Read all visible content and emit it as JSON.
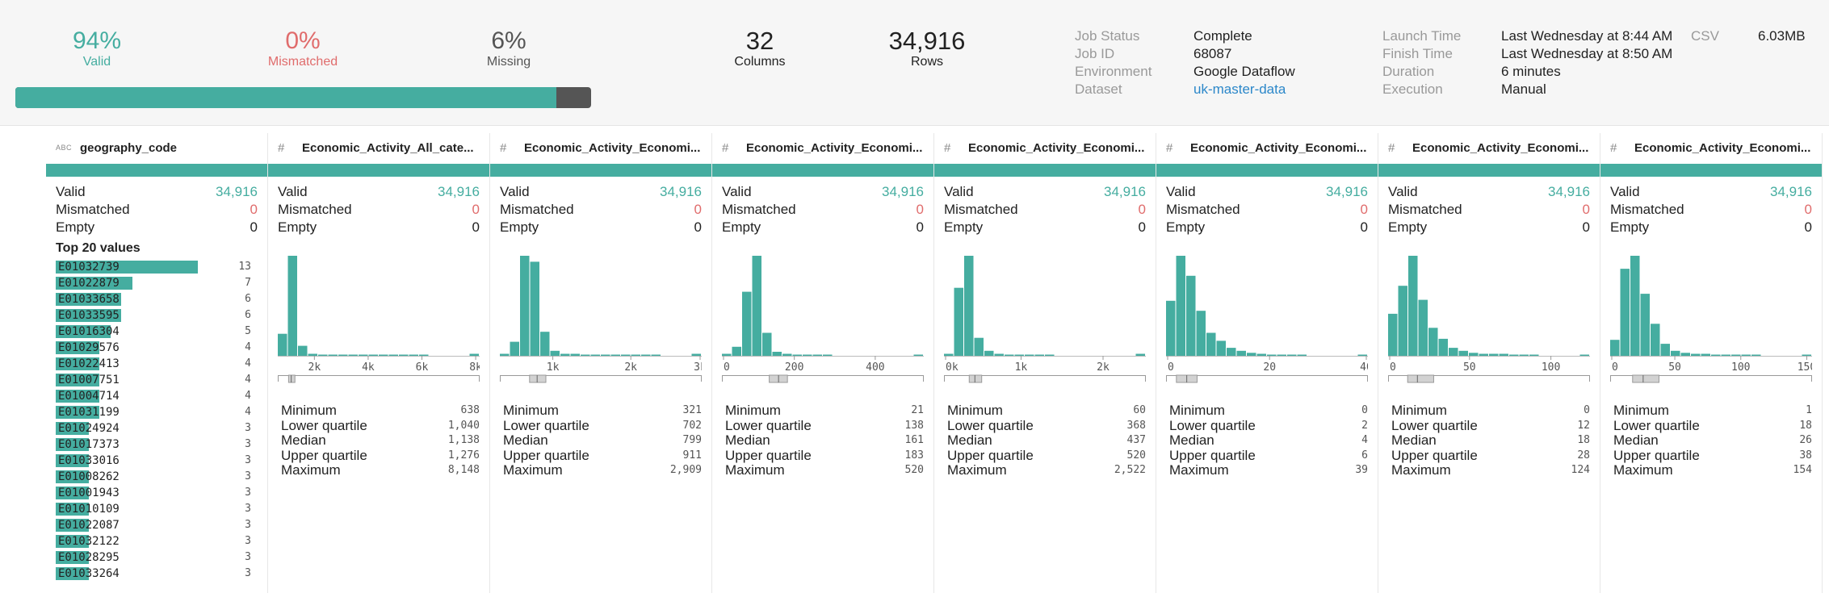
{
  "summary": {
    "valid": {
      "pct": "94%",
      "label": "Valid",
      "fraction": 0.94
    },
    "mismatched": {
      "pct": "0%",
      "label": "Mismatched"
    },
    "missing": {
      "pct": "6%",
      "label": "Missing"
    },
    "columns": {
      "value": "32",
      "label": "Columns"
    },
    "rows": {
      "value": "34,916",
      "label": "Rows"
    }
  },
  "job": {
    "status_label": "Job Status",
    "status": "Complete",
    "id_label": "Job ID",
    "id": "68087",
    "env_label": "Environment",
    "env": "Google Dataflow",
    "dataset_label": "Dataset",
    "dataset": "uk-master-data",
    "launch_label": "Launch Time",
    "launch": "Last Wednesday at 8:44 AM",
    "finish_label": "Finish Time",
    "finish": "Last Wednesday at 8:50 AM",
    "duration_label": "Duration",
    "duration": "6 minutes",
    "execution_label": "Execution",
    "execution": "Manual",
    "output_type": "CSV",
    "output_size": "6.03MB"
  },
  "labels": {
    "valid": "Valid",
    "mismatched": "Mismatched",
    "empty": "Empty",
    "top20": "Top 20 values",
    "minimum": "Minimum",
    "lower_quartile": "Lower quartile",
    "median": "Median",
    "upper_quartile": "Upper quartile",
    "maximum": "Maximum"
  },
  "colors": {
    "accent": "#45ada0",
    "error": "#e06c6c",
    "link": "#2b87c9",
    "missing_bar": "#555555"
  },
  "columns": [
    {
      "type": "ABC",
      "name": "geography_code",
      "valid": "34,916",
      "mismatched": "0",
      "empty": "0",
      "top_values": [
        {
          "value": "E01032739",
          "count": "13"
        },
        {
          "value": "E01022879",
          "count": "7"
        },
        {
          "value": "E01033658",
          "count": "6"
        },
        {
          "value": "E01033595",
          "count": "6"
        },
        {
          "value": "E01016304",
          "count": "5"
        },
        {
          "value": "E01029576",
          "count": "4"
        },
        {
          "value": "E01022413",
          "count": "4"
        },
        {
          "value": "E01007751",
          "count": "4"
        },
        {
          "value": "E01004714",
          "count": "4"
        },
        {
          "value": "E01031199",
          "count": "4"
        },
        {
          "value": "E01024924",
          "count": "3"
        },
        {
          "value": "E01017373",
          "count": "3"
        },
        {
          "value": "E01033016",
          "count": "3"
        },
        {
          "value": "E01008262",
          "count": "3"
        },
        {
          "value": "E01001943",
          "count": "3"
        },
        {
          "value": "E01010109",
          "count": "3"
        },
        {
          "value": "E01022087",
          "count": "3"
        },
        {
          "value": "E01032122",
          "count": "3"
        },
        {
          "value": "E01028295",
          "count": "3"
        },
        {
          "value": "E01033264",
          "count": "3"
        }
      ]
    },
    {
      "type": "#",
      "name": "Economic_Activity_All_cate...",
      "valid": "34,916",
      "mismatched": "0",
      "empty": "0",
      "hist": {
        "bins": [
          0.22,
          1.0,
          0.1,
          0.02,
          0.01,
          0.01,
          0.01,
          0.01,
          0.01,
          0.01,
          0.01,
          0.01,
          0.01,
          0.01,
          0.01,
          0.0,
          0.0,
          0.0,
          0.0,
          0.02
        ],
        "xmin": 638,
        "xmax": 8148,
        "ticks": [
          {
            "v": 2000,
            "label": "2k"
          },
          {
            "v": 4000,
            "label": "4k"
          },
          {
            "v": 6000,
            "label": "6k"
          },
          {
            "v": 8000,
            "label": "8k"
          }
        ]
      },
      "stats": {
        "minimum": "638",
        "lower_quartile": "1,040",
        "median": "1,138",
        "upper_quartile": "1,276",
        "maximum": "8,148"
      },
      "box": {
        "q1": 1040,
        "med": 1138,
        "q3": 1276
      }
    },
    {
      "type": "#",
      "name": "Economic_Activity_Economi...",
      "valid": "34,916",
      "mismatched": "0",
      "empty": "0",
      "hist": {
        "bins": [
          0.02,
          0.14,
          1.0,
          0.94,
          0.24,
          0.05,
          0.02,
          0.02,
          0.01,
          0.01,
          0.01,
          0.01,
          0.01,
          0.01,
          0.01,
          0.01,
          0.0,
          0.0,
          0.0,
          0.02
        ],
        "xmin": 321,
        "xmax": 2909,
        "ticks": [
          {
            "v": 1000,
            "label": "1k"
          },
          {
            "v": 2000,
            "label": "2k"
          },
          {
            "v": 3000,
            "label": "3k"
          }
        ]
      },
      "stats": {
        "minimum": "321",
        "lower_quartile": "702",
        "median": "799",
        "upper_quartile": "911",
        "maximum": "2,909"
      },
      "box": {
        "q1": 702,
        "med": 799,
        "q3": 911
      }
    },
    {
      "type": "#",
      "name": "Economic_Activity_Economi...",
      "valid": "34,916",
      "mismatched": "0",
      "empty": "0",
      "hist": {
        "bins": [
          0.02,
          0.09,
          0.64,
          1.0,
          0.23,
          0.04,
          0.02,
          0.01,
          0.01,
          0.01,
          0.01,
          0.0,
          0.0,
          0.0,
          0.0,
          0.0,
          0.0,
          0.0,
          0.0,
          0.01
        ],
        "xmin": 21,
        "xmax": 520,
        "ticks": [
          {
            "v": 0,
            "label": "0"
          },
          {
            "v": 200,
            "label": "200"
          },
          {
            "v": 400,
            "label": "400"
          }
        ]
      },
      "stats": {
        "minimum": "21",
        "lower_quartile": "138",
        "median": "161",
        "upper_quartile": "183",
        "maximum": "520"
      },
      "box": {
        "q1": 138,
        "med": 161,
        "q3": 183
      }
    },
    {
      "type": "#",
      "name": "Economic_Activity_Economi...",
      "valid": "34,916",
      "mismatched": "0",
      "empty": "0",
      "hist": {
        "bins": [
          0.02,
          0.68,
          1.0,
          0.18,
          0.05,
          0.02,
          0.01,
          0.01,
          0.01,
          0.01,
          0.01,
          0.0,
          0.0,
          0.0,
          0.0,
          0.0,
          0.0,
          0.0,
          0.0,
          0.02
        ],
        "xmin": 60,
        "xmax": 2522,
        "ticks": [
          {
            "v": 0,
            "label": "0k"
          },
          {
            "v": 1000,
            "label": "1k"
          },
          {
            "v": 2000,
            "label": "2k"
          }
        ]
      },
      "stats": {
        "minimum": "60",
        "lower_quartile": "368",
        "median": "437",
        "upper_quartile": "520",
        "maximum": "2,522"
      },
      "box": {
        "q1": 368,
        "med": 437,
        "q3": 520
      }
    },
    {
      "type": "#",
      "name": "Economic_Activity_Economi...",
      "valid": "34,916",
      "mismatched": "0",
      "empty": "0",
      "hist": {
        "bins": [
          0.55,
          1.0,
          0.8,
          0.45,
          0.23,
          0.15,
          0.08,
          0.05,
          0.03,
          0.02,
          0.01,
          0.01,
          0.01,
          0.01,
          0.0,
          0.0,
          0.0,
          0.0,
          0.0,
          0.01
        ],
        "xmin": 0,
        "xmax": 39,
        "ticks": [
          {
            "v": 0,
            "label": "0"
          },
          {
            "v": 20,
            "label": "20"
          },
          {
            "v": 40,
            "label": "40"
          }
        ]
      },
      "stats": {
        "minimum": "0",
        "lower_quartile": "2",
        "median": "4",
        "upper_quartile": "6",
        "maximum": "39"
      },
      "box": {
        "q1": 2,
        "med": 4,
        "q3": 6
      }
    },
    {
      "type": "#",
      "name": "Economic_Activity_Economi...",
      "valid": "34,916",
      "mismatched": "0",
      "empty": "0",
      "hist": {
        "bins": [
          0.42,
          0.7,
          1.0,
          0.56,
          0.28,
          0.17,
          0.08,
          0.05,
          0.03,
          0.02,
          0.02,
          0.02,
          0.01,
          0.01,
          0.01,
          0.0,
          0.0,
          0.0,
          0.0,
          0.01
        ],
        "xmin": 0,
        "xmax": 124,
        "ticks": [
          {
            "v": 0,
            "label": "0"
          },
          {
            "v": 50,
            "label": "50"
          },
          {
            "v": 100,
            "label": "100"
          }
        ]
      },
      "stats": {
        "minimum": "0",
        "lower_quartile": "12",
        "median": "18",
        "upper_quartile": "28",
        "maximum": "124"
      },
      "box": {
        "q1": 12,
        "med": 18,
        "q3": 28
      }
    },
    {
      "type": "#",
      "name": "Economic_Activity_Economi...",
      "valid": "34,916",
      "mismatched": "0",
      "empty": "0",
      "hist": {
        "bins": [
          0.16,
          0.87,
          1.0,
          0.62,
          0.32,
          0.12,
          0.05,
          0.03,
          0.02,
          0.02,
          0.01,
          0.01,
          0.01,
          0.01,
          0.01,
          0.0,
          0.0,
          0.0,
          0.0,
          0.01
        ],
        "xmin": 1,
        "xmax": 154,
        "ticks": [
          {
            "v": 0,
            "label": "0"
          },
          {
            "v": 50,
            "label": "50"
          },
          {
            "v": 100,
            "label": "100"
          },
          {
            "v": 150,
            "label": "150"
          }
        ]
      },
      "stats": {
        "minimum": "1",
        "lower_quartile": "18",
        "median": "26",
        "upper_quartile": "38",
        "maximum": "154"
      },
      "box": {
        "q1": 18,
        "med": 26,
        "q3": 38
      }
    }
  ]
}
